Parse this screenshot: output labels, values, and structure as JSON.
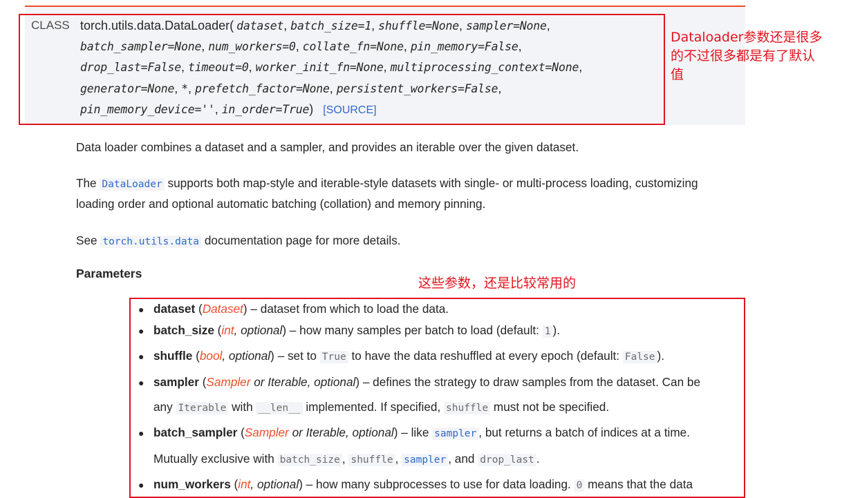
{
  "signature": {
    "kind": "CLASS",
    "name": "torch.utils.data.DataLoader",
    "lines": [
      [
        {
          "t": "dataset",
          "s": "em"
        },
        {
          "t": ", ",
          "s": "plain"
        },
        {
          "t": "batch_size=1",
          "s": "em"
        },
        {
          "t": ", ",
          "s": "plain"
        },
        {
          "t": "shuffle=None",
          "s": "em"
        },
        {
          "t": ", ",
          "s": "plain"
        },
        {
          "t": "sampler=None",
          "s": "em"
        },
        {
          "t": ",",
          "s": "plain"
        }
      ],
      [
        {
          "t": "batch_sampler=None",
          "s": "em"
        },
        {
          "t": ", ",
          "s": "plain"
        },
        {
          "t": "num_workers=0",
          "s": "em"
        },
        {
          "t": ", ",
          "s": "plain"
        },
        {
          "t": "collate_fn=None",
          "s": "em"
        },
        {
          "t": ", ",
          "s": "plain"
        },
        {
          "t": "pin_memory=False",
          "s": "em"
        },
        {
          "t": ",",
          "s": "plain"
        }
      ],
      [
        {
          "t": "drop_last=False",
          "s": "em"
        },
        {
          "t": ", ",
          "s": "plain"
        },
        {
          "t": "timeout=0",
          "s": "em"
        },
        {
          "t": ", ",
          "s": "plain"
        },
        {
          "t": "worker_init_fn=None",
          "s": "em"
        },
        {
          "t": ", ",
          "s": "plain"
        },
        {
          "t": "multiprocessing_context=None",
          "s": "em"
        },
        {
          "t": ",",
          "s": "plain"
        }
      ],
      [
        {
          "t": "generator=None",
          "s": "em"
        },
        {
          "t": ", ",
          "s": "plain"
        },
        {
          "t": "*",
          "s": "em"
        },
        {
          "t": ", ",
          "s": "plain"
        },
        {
          "t": "prefetch_factor=None",
          "s": "em"
        },
        {
          "t": ", ",
          "s": "plain"
        },
        {
          "t": "persistent_workers=False",
          "s": "em"
        },
        {
          "t": ",",
          "s": "plain"
        }
      ],
      [
        {
          "t": "pin_memory_device=''",
          "s": "em"
        },
        {
          "t": ", ",
          "s": "plain"
        },
        {
          "t": "in_order=True",
          "s": "em"
        },
        {
          "t": ")",
          "s": "plain"
        }
      ]
    ],
    "open_paren": "(",
    "source_link": "[SOURCE]"
  },
  "annotations": {
    "signature_note": [
      "Dataloader参数还是很多",
      "的不过很多都是有了默认",
      "值"
    ],
    "params_note": "这些参数，还是比较常用的"
  },
  "paragraphs": [
    [
      {
        "t": "Data loader combines a dataset and a sampler, and provides an iterable over the given dataset.",
        "s": "text"
      }
    ],
    [
      {
        "t": "The ",
        "s": "text"
      },
      {
        "t": "DataLoader",
        "s": "codelink"
      },
      {
        "t": " supports both map-style and iterable-style datasets with single- or multi-process loading, customizing",
        "s": "text"
      }
    ],
    [
      {
        "t": "loading order and optional automatic batching (collation) and memory pinning.",
        "s": "text"
      }
    ],
    [
      {
        "t": "See ",
        "s": "text"
      },
      {
        "t": "torch.utils.data",
        "s": "codelink"
      },
      {
        "t": " documentation page for more details.",
        "s": "text"
      }
    ]
  ],
  "parameters_heading": "Parameters",
  "parameters": [
    [
      {
        "t": "dataset",
        "s": "name"
      },
      {
        "t": " (",
        "s": "text"
      },
      {
        "t": "Dataset",
        "s": "type"
      },
      {
        "t": ") – dataset from which to load the data.",
        "s": "text"
      }
    ],
    [
      {
        "t": "batch_size",
        "s": "name"
      },
      {
        "t": " (",
        "s": "text"
      },
      {
        "t": "int",
        "s": "type"
      },
      {
        "t": ", optional",
        "s": "opt"
      },
      {
        "t": ") – how many samples per batch to load (default: ",
        "s": "text"
      },
      {
        "t": "1",
        "s": "code"
      },
      {
        "t": ").",
        "s": "text"
      }
    ],
    [
      {
        "t": "shuffle",
        "s": "name"
      },
      {
        "t": " (",
        "s": "text"
      },
      {
        "t": "bool",
        "s": "type"
      },
      {
        "t": ", optional",
        "s": "opt"
      },
      {
        "t": ") – set to ",
        "s": "text"
      },
      {
        "t": "True",
        "s": "code"
      },
      {
        "t": " to have the data reshuffled at every epoch (default: ",
        "s": "text"
      },
      {
        "t": "False",
        "s": "code"
      },
      {
        "t": ").",
        "s": "text"
      }
    ],
    [
      {
        "t": "sampler",
        "s": "name"
      },
      {
        "t": " (",
        "s": "text"
      },
      {
        "t": "Sampler",
        "s": "type"
      },
      {
        "t": " or Iterable, optional",
        "s": "opt"
      },
      {
        "t": ") – defines the strategy to draw samples from the dataset. Can be",
        "s": "text"
      }
    ],
    [
      {
        "t": "batch_sampler",
        "s": "name"
      },
      {
        "t": " (",
        "s": "text"
      },
      {
        "t": "Sampler",
        "s": "type"
      },
      {
        "t": " or Iterable, optional",
        "s": "opt"
      },
      {
        "t": ") – like ",
        "s": "text"
      },
      {
        "t": "sampler",
        "s": "codelink"
      },
      {
        "t": ", but returns a batch of indices at a time.",
        "s": "text"
      }
    ],
    [
      {
        "t": "num_workers",
        "s": "name"
      },
      {
        "t": " (",
        "s": "text"
      },
      {
        "t": "int",
        "s": "type"
      },
      {
        "t": ", optional",
        "s": "opt"
      },
      {
        "t": ") – how many subprocesses to use for data loading. ",
        "s": "text"
      },
      {
        "t": "0",
        "s": "code"
      },
      {
        "t": " means that the data",
        "s": "text"
      }
    ]
  ],
  "continuations": [
    [
      {
        "t": "any ",
        "s": "text"
      },
      {
        "t": "Iterable",
        "s": "code"
      },
      {
        "t": " with ",
        "s": "text"
      },
      {
        "t": "__len__",
        "s": "code"
      },
      {
        "t": " implemented. If specified, ",
        "s": "text"
      },
      {
        "t": "shuffle",
        "s": "code"
      },
      {
        "t": " must not be specified.",
        "s": "text"
      }
    ],
    [
      {
        "t": "Mutually exclusive with ",
        "s": "text"
      },
      {
        "t": "batch_size",
        "s": "code"
      },
      {
        "t": ", ",
        "s": "text"
      },
      {
        "t": "shuffle",
        "s": "code"
      },
      {
        "t": ", ",
        "s": "text"
      },
      {
        "t": "sampler",
        "s": "codelink"
      },
      {
        "t": ", and ",
        "s": "text"
      },
      {
        "t": "drop_last",
        "s": "code"
      },
      {
        "t": ".",
        "s": "text"
      }
    ]
  ]
}
